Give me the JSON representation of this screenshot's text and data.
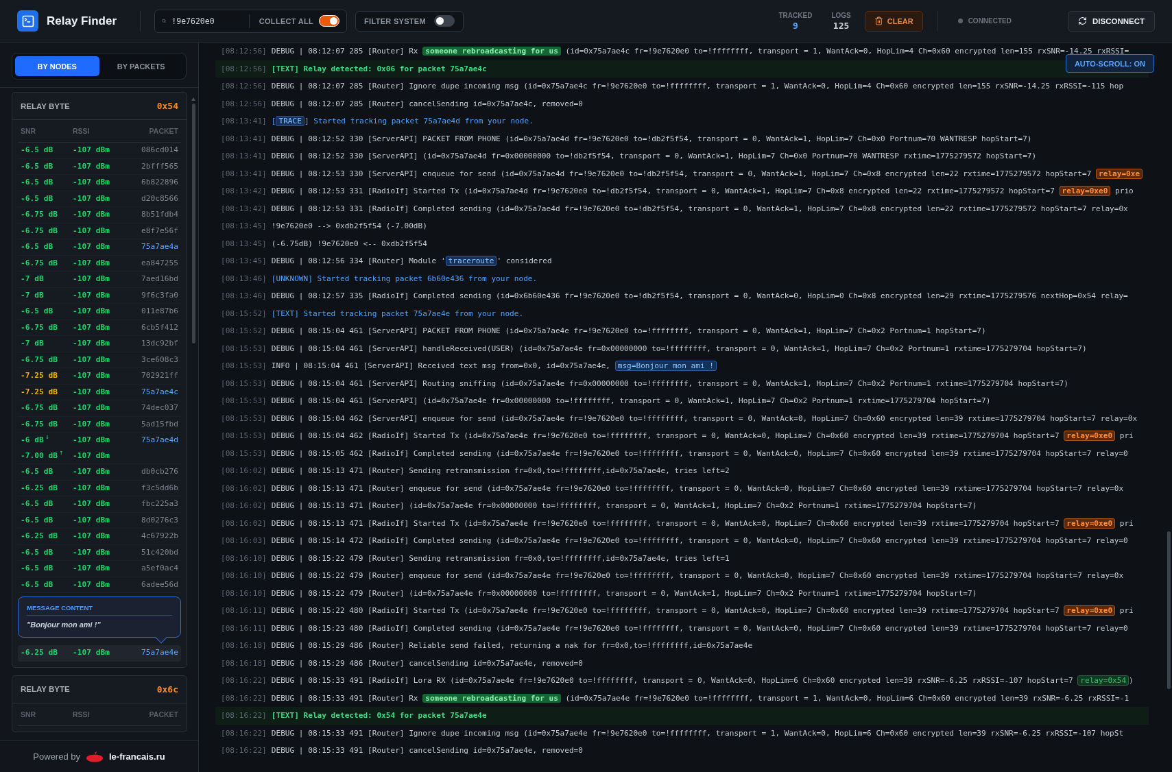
{
  "header": {
    "title": "Relay Finder",
    "search": {
      "value": "!9e7620e0"
    },
    "collect_all": {
      "label": "COLLECT ALL",
      "on": true
    },
    "filter_system": {
      "label": "FILTER SYSTEM",
      "on": false
    },
    "stats": [
      {
        "label": "TRACKED",
        "value": "9",
        "kind": "accent"
      },
      {
        "label": "LOGS",
        "value": "125",
        "kind": "plain"
      }
    ],
    "clear_button": "CLEAR",
    "status": {
      "label": "CONNECTED",
      "connected": false
    },
    "disconnect_button": "DISCONNECT"
  },
  "sidebar": {
    "tabs": [
      {
        "label": "BY NODES",
        "selected": true
      },
      {
        "label": "BY PACKETS",
        "selected": false
      }
    ],
    "cards": [
      {
        "label": "RELAY BYTE",
        "value": "0x54",
        "columns": [
          "SNR",
          "RSSI",
          "PACKET"
        ],
        "tooltip": {
          "title": "MESSAGE CONTENT",
          "text": "\"Bonjour mon ami !\""
        },
        "rows": [
          {
            "packet": "086cd014",
            "tracked": false,
            "hovered": false,
            "readings": [
              {
                "snr": "-6.5 dB",
                "rssi": "-107 dBm",
                "color": "#22d36b"
              }
            ]
          },
          {
            "packet": "2bfff565",
            "tracked": false,
            "hovered": false,
            "readings": [
              {
                "snr": "-6.5 dB",
                "rssi": "-107 dBm",
                "color": "#22d36b"
              }
            ]
          },
          {
            "packet": "6b822896",
            "tracked": false,
            "hovered": false,
            "readings": [
              {
                "snr": "-6.5 dB",
                "rssi": "-107 dBm",
                "color": "#22d36b"
              }
            ]
          },
          {
            "packet": "d20c8566",
            "tracked": false,
            "hovered": false,
            "readings": [
              {
                "snr": "-6.5 dB",
                "rssi": "-107 dBm",
                "color": "#22d36b"
              }
            ]
          },
          {
            "packet": "8b51fdb4",
            "tracked": false,
            "hovered": false,
            "readings": [
              {
                "snr": "-6.75 dB",
                "rssi": "-107 dBm",
                "color": "#22d36b"
              }
            ]
          },
          {
            "packet": "e8f7e56f",
            "tracked": false,
            "hovered": false,
            "readings": [
              {
                "snr": "-6.75 dB",
                "rssi": "-107 dBm",
                "color": "#22d36b"
              }
            ]
          },
          {
            "packet": "75a7ae4a",
            "tracked": true,
            "hovered": false,
            "readings": [
              {
                "snr": "-6.5 dB",
                "rssi": "-107 dBm",
                "color": "#22d36b"
              }
            ]
          },
          {
            "packet": "ea847255",
            "tracked": false,
            "hovered": false,
            "readings": [
              {
                "snr": "-6.75 dB",
                "rssi": "-107 dBm",
                "color": "#22d36b"
              }
            ]
          },
          {
            "packet": "7aed16bd",
            "tracked": false,
            "hovered": false,
            "readings": [
              {
                "snr": "-7 dB",
                "rssi": "-107 dBm",
                "color": "#22d36b"
              }
            ]
          },
          {
            "packet": "9f6c3fa0",
            "tracked": false,
            "hovered": false,
            "readings": [
              {
                "snr": "-7 dB",
                "rssi": "-107 dBm",
                "color": "#22d36b"
              }
            ]
          },
          {
            "packet": "011e87b6",
            "tracked": false,
            "hovered": false,
            "readings": [
              {
                "snr": "-6.5 dB",
                "rssi": "-107 dBm",
                "color": "#22d36b"
              }
            ]
          },
          {
            "packet": "6cb5f412",
            "tracked": false,
            "hovered": false,
            "readings": [
              {
                "snr": "-6.75 dB",
                "rssi": "-107 dBm",
                "color": "#22d36b"
              }
            ]
          },
          {
            "packet": "13dc92bf",
            "tracked": false,
            "hovered": false,
            "readings": [
              {
                "snr": "-7 dB",
                "rssi": "-107 dBm",
                "color": "#22d36b"
              }
            ]
          },
          {
            "packet": "3ce608c3",
            "tracked": false,
            "hovered": false,
            "readings": [
              {
                "snr": "-6.75 dB",
                "rssi": "-107 dBm",
                "color": "#22d36b"
              }
            ]
          },
          {
            "packet": "702921ff",
            "tracked": false,
            "hovered": false,
            "readings": [
              {
                "snr": "-7.25 dB",
                "rssi": "-107 dBm",
                "color": "#f5b400"
              }
            ]
          },
          {
            "packet": "75a7ae4c",
            "tracked": true,
            "hovered": false,
            "readings": [
              {
                "snr": "-7.25 dB",
                "rssi": "-107 dBm",
                "color": "#f5b400"
              }
            ]
          },
          {
            "packet": "74dec037",
            "tracked": false,
            "hovered": false,
            "readings": [
              {
                "snr": "-6.75 dB",
                "rssi": "-107 dBm",
                "color": "#22d36b"
              }
            ]
          },
          {
            "packet": "5ad15fbd",
            "tracked": false,
            "hovered": false,
            "readings": [
              {
                "snr": "-6.75 dB",
                "rssi": "-107 dBm",
                "color": "#22d36b"
              }
            ]
          },
          {
            "packet": "75a7ae4d",
            "tracked": true,
            "hovered": false,
            "readings": [
              {
                "snr": "-6 dB",
                "trend": "↓",
                "rssi": "-107 dBm",
                "color": "#22d36b"
              },
              {
                "snr": "-7.00 dB",
                "trend": "↑",
                "rssi": "-107 dBm",
                "color": "#22d36b"
              }
            ]
          },
          {
            "packet": "db0cb276",
            "tracked": false,
            "hovered": false,
            "readings": [
              {
                "snr": "-6.5 dB",
                "rssi": "-107 dBm",
                "color": "#22d36b"
              }
            ]
          },
          {
            "packet": "f3c5dd6b",
            "tracked": false,
            "hovered": false,
            "readings": [
              {
                "snr": "-6.25 dB",
                "rssi": "-107 dBm",
                "color": "#22d36b"
              }
            ]
          },
          {
            "packet": "fbc225a3",
            "tracked": false,
            "hovered": false,
            "readings": [
              {
                "snr": "-6.5 dB",
                "rssi": "-107 dBm",
                "color": "#22d36b"
              }
            ]
          },
          {
            "packet": "8d0276c3",
            "tracked": false,
            "hovered": false,
            "readings": [
              {
                "snr": "-6.5 dB",
                "rssi": "-107 dBm",
                "color": "#22d36b"
              }
            ]
          },
          {
            "packet": "4c67922b",
            "tracked": false,
            "hovered": false,
            "readings": [
              {
                "snr": "-6.25 dB",
                "rssi": "-107 dBm",
                "color": "#22d36b"
              }
            ]
          },
          {
            "packet": "51c420bd",
            "tracked": false,
            "hovered": false,
            "readings": [
              {
                "snr": "-6.5 dB",
                "rssi": "-107 dBm",
                "color": "#22d36b"
              }
            ]
          },
          {
            "packet": "a5ef0ac4",
            "tracked": false,
            "hovered": false,
            "readings": [
              {
                "snr": "-6.5 dB",
                "rssi": "-107 dBm",
                "color": "#22d36b"
              }
            ]
          },
          {
            "packet": "6adee56d",
            "tracked": false,
            "hovered": false,
            "readings": [
              {
                "snr": "-6.5 dB",
                "rssi": "-107 dBm",
                "color": "#22d36b"
              }
            ]
          },
          {
            "packet": "75a7ae4e",
            "tracked": true,
            "hovered": true,
            "readings": [
              {
                "snr": "-6.25 dB",
                "rssi": "-107 dBm",
                "color": "#22d36b"
              }
            ]
          }
        ]
      },
      {
        "label": "RELAY BYTE",
        "value": "0x6c",
        "columns": [
          "SNR",
          "RSSI",
          "PACKET"
        ]
      }
    ],
    "footer": {
      "prefix": "Powered by",
      "brand": "le-francais.ru"
    }
  },
  "log": {
    "auto_scroll": {
      "label": "AUTO-SCROLL: ON",
      "on": true
    },
    "lines": [
      {
        "time": "[08:12:56]",
        "kind": "debug",
        "parts": [
          {
            "kind": "plain",
            "text": "DEBUG | 08:12:07 285 [Router] Rx "
          },
          {
            "kind": "rebroadcast",
            "text": "someone rebroadcasting for us"
          },
          {
            "kind": "plain",
            "text": " (id=0x75a7ae4c fr=!9e7620e0 to=!ffffffff, transport = 1, WantAck=0, HopLim=4 Ch=0x60 encrypted len=155 rxSNR=-14.25 rxRSSI="
          }
        ]
      },
      {
        "time": "[08:12:56]",
        "kind": "relay",
        "parts": [
          {
            "kind": "plain",
            "text": "[TEXT] Relay detected: 0x06 for packet 75a7ae4c"
          }
        ]
      },
      {
        "time": "[08:12:56]",
        "kind": "debug",
        "parts": [
          {
            "kind": "plain",
            "text": "DEBUG | 08:12:07 285 [Router] Ignore dupe incoming msg (id=0x75a7ae4c fr=!9e7620e0 to=!ffffffff, transport = 1, WantAck=0, HopLim=4 Ch=0x60 encrypted len=155 rxSNR=-14.25 rxRSSI=-115 hop"
          }
        ]
      },
      {
        "time": "[08:12:56]",
        "kind": "debug",
        "parts": [
          {
            "kind": "plain",
            "text": "DEBUG | 08:12:07 285 [Router] cancelSending id=0x75a7ae4c, removed=0"
          }
        ]
      },
      {
        "time": "[08:13:41]",
        "kind": "tracking",
        "parts": [
          {
            "kind": "plain",
            "text": "["
          },
          {
            "kind": "info",
            "text": "TRACE"
          },
          {
            "kind": "plain",
            "text": "] Started tracking packet 75a7ae4d from your node."
          }
        ]
      },
      {
        "time": "[08:13:41]",
        "kind": "debug",
        "parts": [
          {
            "kind": "plain",
            "text": "DEBUG | 08:12:52 330 [ServerAPI] PACKET FROM PHONE (id=0x75a7ae4d fr=!9e7620e0 to=!db2f5f54, transport = 0, WantAck=1, HopLim=7 Ch=0x0 Portnum=70 WANTRESP hopStart=7)"
          }
        ]
      },
      {
        "time": "[08:13:41]",
        "kind": "debug",
        "parts": [
          {
            "kind": "plain",
            "text": "DEBUG | 08:12:52 330 [ServerAPI] (id=0x75a7ae4d fr=0x00000000 to=!db2f5f54, transport = 0, WantAck=1, HopLim=7 Ch=0x0 Portnum=70 WANTRESP rxtime=1775279572 hopStart=7)"
          }
        ]
      },
      {
        "time": "[08:13:41]",
        "kind": "debug",
        "parts": [
          {
            "kind": "plain",
            "text": "DEBUG | 08:12:53 330 [ServerAPI] enqueue for send (id=0x75a7ae4d fr=!9e7620e0 to=!db2f5f54, transport = 0, WantAck=1, HopLim=7 Ch=0x8 encrypted len=22 rxtime=1775279572 hopStart=7 "
          },
          {
            "kind": "relay",
            "text": "relay=0xe"
          }
        ]
      },
      {
        "time": "[08:13:42]",
        "kind": "debug",
        "parts": [
          {
            "kind": "plain",
            "text": "DEBUG | 08:12:53 331 [RadioIf] Started Tx (id=0x75a7ae4d fr=!9e7620e0 to=!db2f5f54, transport = 0, WantAck=1, HopLim=7 Ch=0x8 encrypted len=22 rxtime=1775279572 hopStart=7 "
          },
          {
            "kind": "relay",
            "text": "relay=0xe0"
          },
          {
            "kind": "plain",
            "text": " prio"
          }
        ]
      },
      {
        "time": "[08:13:42]",
        "kind": "debug",
        "parts": [
          {
            "kind": "plain",
            "text": "DEBUG | 08:12:53 331 [RadioIf] Completed sending (id=0x75a7ae4d fr=!9e7620e0 to=!db2f5f54, transport = 0, WantAck=1, HopLim=7 Ch=0x8 encrypted len=22 rxtime=1775279572 hopStart=7 relay=0x"
          }
        ]
      },
      {
        "time": "[08:13:45]",
        "kind": "debug",
        "parts": [
          {
            "kind": "plain",
            "text": "!9e7620e0 --> 0xdb2f5f54 (-7.00dB)"
          }
        ]
      },
      {
        "time": "[08:13:45]",
        "kind": "debug",
        "parts": [
          {
            "kind": "plain",
            "text": "(-6.75dB) !9e7620e0 <-- 0xdb2f5f54"
          }
        ]
      },
      {
        "time": "[08:13:45]",
        "kind": "debug",
        "parts": [
          {
            "kind": "plain",
            "text": "DEBUG | 08:12:56 334 [Router] Module '"
          },
          {
            "kind": "info",
            "text": "traceroute"
          },
          {
            "kind": "plain",
            "text": "' considered"
          }
        ]
      },
      {
        "time": "[08:13:46]",
        "kind": "tracking",
        "parts": [
          {
            "kind": "plain",
            "text": "[UNKNOWN] Started tracking packet 6b60e436 from your node."
          }
        ]
      },
      {
        "time": "[08:13:46]",
        "kind": "debug",
        "parts": [
          {
            "kind": "plain",
            "text": "DEBUG | 08:12:57 335 [RadioIf] Completed sending (id=0x6b60e436 fr=!9e7620e0 to=!db2f5f54, transport = 0, WantAck=0, HopLim=0 Ch=0x8 encrypted len=29 rxtime=1775279576 nextHop=0x54 relay="
          }
        ]
      },
      {
        "time": "[08:15:52]",
        "kind": "tracking",
        "parts": [
          {
            "kind": "plain",
            "text": "[TEXT] Started tracking packet 75a7ae4e from your node."
          }
        ]
      },
      {
        "time": "[08:15:52]",
        "kind": "debug",
        "parts": [
          {
            "kind": "plain",
            "text": "DEBUG | 08:15:04 461 [ServerAPI] PACKET FROM PHONE (id=0x75a7ae4e fr=!9e7620e0 to=!ffffffff, transport = 0, WantAck=1, HopLim=7 Ch=0x2 Portnum=1 hopStart=7)"
          }
        ]
      },
      {
        "time": "[08:15:53]",
        "kind": "debug",
        "parts": [
          {
            "kind": "plain",
            "text": "DEBUG | 08:15:04 461 [ServerAPI] handleReceived(USER) (id=0x75a7ae4e fr=0x00000000 to=!ffffffff, transport = 0, WantAck=1, HopLim=7 Ch=0x2 Portnum=1 rxtime=1775279704 hopStart=7)"
          }
        ]
      },
      {
        "time": "[08:15:53]",
        "kind": "debug",
        "parts": [
          {
            "kind": "plain",
            "text": "INFO | 08:15:04 461 [ServerAPI] Received text msg from=0x0, id=0x75a7ae4e, "
          },
          {
            "kind": "info",
            "text": "msg=Bonjour mon ami !"
          }
        ]
      },
      {
        "time": "[08:15:53]",
        "kind": "debug",
        "parts": [
          {
            "kind": "plain",
            "text": "DEBUG | 08:15:04 461 [ServerAPI] Routing sniffing (id=0x75a7ae4e fr=0x00000000 to=!ffffffff, transport = 0, WantAck=1, HopLim=7 Ch=0x2 Portnum=1 rxtime=1775279704 hopStart=7)"
          }
        ]
      },
      {
        "time": "[08:15:53]",
        "kind": "debug",
        "parts": [
          {
            "kind": "plain",
            "text": "DEBUG | 08:15:04 461 [ServerAPI] (id=0x75a7ae4e fr=0x00000000 to=!ffffffff, transport = 0, WantAck=1, HopLim=7 Ch=0x2 Portnum=1 rxtime=1775279704 hopStart=7)"
          }
        ]
      },
      {
        "time": "[08:15:53]",
        "kind": "debug",
        "parts": [
          {
            "kind": "plain",
            "text": "DEBUG | 08:15:04 462 [ServerAPI] enqueue for send (id=0x75a7ae4e fr=!9e7620e0 to=!ffffffff, transport = 0, WantAck=0, HopLim=7 Ch=0x60 encrypted len=39 rxtime=1775279704 hopStart=7 relay=0x"
          }
        ]
      },
      {
        "time": "[08:15:53]",
        "kind": "debug",
        "parts": [
          {
            "kind": "plain",
            "text": "DEBUG | 08:15:04 462 [RadioIf] Started Tx (id=0x75a7ae4e fr=!9e7620e0 to=!ffffffff, transport = 0, WantAck=0, HopLim=7 Ch=0x60 encrypted len=39 rxtime=1775279704 hopStart=7 "
          },
          {
            "kind": "relay",
            "text": "relay=0xe0"
          },
          {
            "kind": "plain",
            "text": " pri"
          }
        ]
      },
      {
        "time": "[08:15:53]",
        "kind": "debug",
        "parts": [
          {
            "kind": "plain",
            "text": "DEBUG | 08:15:05 462 [RadioIf] Completed sending (id=0x75a7ae4e fr=!9e7620e0 to=!ffffffff, transport = 0, WantAck=0, HopLim=7 Ch=0x60 encrypted len=39 rxtime=1775279704 hopStart=7 relay=0"
          }
        ]
      },
      {
        "time": "[08:16:02]",
        "kind": "debug",
        "parts": [
          {
            "kind": "plain",
            "text": "DEBUG | 08:15:13 471 [Router] Sending retransmission fr=0x0,to=!ffffffff,id=0x75a7ae4e, tries left=2"
          }
        ]
      },
      {
        "time": "[08:16:02]",
        "kind": "debug",
        "parts": [
          {
            "kind": "plain",
            "text": "DEBUG | 08:15:13 471 [Router] enqueue for send (id=0x75a7ae4e fr=!9e7620e0 to=!ffffffff, transport = 0, WantAck=0, HopLim=7 Ch=0x60 encrypted len=39 rxtime=1775279704 hopStart=7 relay=0x"
          }
        ]
      },
      {
        "time": "[08:16:02]",
        "kind": "debug",
        "parts": [
          {
            "kind": "plain",
            "text": "DEBUG | 08:15:13 471 [Router] (id=0x75a7ae4e fr=0x00000000 to=!ffffffff, transport = 0, WantAck=1, HopLim=7 Ch=0x2 Portnum=1 rxtime=1775279704 hopStart=7)"
          }
        ]
      },
      {
        "time": "[08:16:02]",
        "kind": "debug",
        "parts": [
          {
            "kind": "plain",
            "text": "DEBUG | 08:15:13 471 [RadioIf] Started Tx (id=0x75a7ae4e fr=!9e7620e0 to=!ffffffff, transport = 0, WantAck=0, HopLim=7 Ch=0x60 encrypted len=39 rxtime=1775279704 hopStart=7 "
          },
          {
            "kind": "relay",
            "text": "relay=0xe0"
          },
          {
            "kind": "plain",
            "text": " pri"
          }
        ]
      },
      {
        "time": "[08:16:03]",
        "kind": "debug",
        "parts": [
          {
            "kind": "plain",
            "text": "DEBUG | 08:15:14 472 [RadioIf] Completed sending (id=0x75a7ae4e fr=!9e7620e0 to=!ffffffff, transport = 0, WantAck=0, HopLim=7 Ch=0x60 encrypted len=39 rxtime=1775279704 hopStart=7 relay=0"
          }
        ]
      },
      {
        "time": "[08:16:10]",
        "kind": "debug",
        "parts": [
          {
            "kind": "plain",
            "text": "DEBUG | 08:15:22 479 [Router] Sending retransmission fr=0x0,to=!ffffffff,id=0x75a7ae4e, tries left=1"
          }
        ]
      },
      {
        "time": "[08:16:10]",
        "kind": "debug",
        "parts": [
          {
            "kind": "plain",
            "text": "DEBUG | 08:15:22 479 [Router] enqueue for send (id=0x75a7ae4e fr=!9e7620e0 to=!ffffffff, transport = 0, WantAck=0, HopLim=7 Ch=0x60 encrypted len=39 rxtime=1775279704 hopStart=7 relay=0x"
          }
        ]
      },
      {
        "time": "[08:16:10]",
        "kind": "debug",
        "parts": [
          {
            "kind": "plain",
            "text": "DEBUG | 08:15:22 479 [Router] (id=0x75a7ae4e fr=0x00000000 to=!ffffffff, transport = 0, WantAck=1, HopLim=7 Ch=0x2 Portnum=1 rxtime=1775279704 hopStart=7)"
          }
        ]
      },
      {
        "time": "[08:16:11]",
        "kind": "debug",
        "parts": [
          {
            "kind": "plain",
            "text": "DEBUG | 08:15:22 480 [RadioIf] Started Tx (id=0x75a7ae4e fr=!9e7620e0 to=!ffffffff, transport = 0, WantAck=0, HopLim=7 Ch=0x60 encrypted len=39 rxtime=1775279704 hopStart=7 "
          },
          {
            "kind": "relay",
            "text": "relay=0xe0"
          },
          {
            "kind": "plain",
            "text": " pri"
          }
        ]
      },
      {
        "time": "[08:16:11]",
        "kind": "debug",
        "parts": [
          {
            "kind": "plain",
            "text": "DEBUG | 08:15:23 480 [RadioIf] Completed sending (id=0x75a7ae4e fr=!9e7620e0 to=!ffffffff, transport = 0, WantAck=0, HopLim=7 Ch=0x60 encrypted len=39 rxtime=1775279704 hopStart=7 relay=0"
          }
        ]
      },
      {
        "time": "[08:16:18]",
        "kind": "debug",
        "parts": [
          {
            "kind": "plain",
            "text": "DEBUG | 08:15:29 486 [Router] Reliable send failed, returning a nak for fr=0x0,to=!ffffffff,id=0x75a7ae4e"
          }
        ]
      },
      {
        "time": "[08:16:18]",
        "kind": "debug",
        "parts": [
          {
            "kind": "plain",
            "text": "DEBUG | 08:15:29 486 [Router] cancelSending id=0x75a7ae4e, removed=0"
          }
        ]
      },
      {
        "time": "[08:16:22]",
        "kind": "debug",
        "parts": [
          {
            "kind": "plain",
            "text": "DEBUG | 08:15:33 491 [RadioIf] Lora RX (id=0x75a7ae4e fr=!9e7620e0 to=!ffffffff, transport = 0, WantAck=0, HopLim=6 Ch=0x60 encrypted len=39 rxSNR=-6.25 rxRSSI=-107 hopStart=7 "
          },
          {
            "kind": "match",
            "text": "relay=0x54"
          },
          {
            "kind": "plain",
            "text": ")"
          }
        ]
      },
      {
        "time": "[08:16:22]",
        "kind": "debug",
        "parts": [
          {
            "kind": "plain",
            "text": "DEBUG | 08:15:33 491 [Router] Rx "
          },
          {
            "kind": "rebroadcast",
            "text": "someone rebroadcasting for us"
          },
          {
            "kind": "plain",
            "text": " (id=0x75a7ae4e fr=!9e7620e0 to=!ffffffff, transport = 1, WantAck=0, HopLim=6 Ch=0x60 encrypted len=39 rxSNR=-6.25 rxRSSI=-1"
          }
        ]
      },
      {
        "time": "[08:16:22]",
        "kind": "relay",
        "parts": [
          {
            "kind": "plain",
            "text": "[TEXT] Relay detected: 0x54 for packet 75a7ae4e"
          }
        ]
      },
      {
        "time": "[08:16:22]",
        "kind": "debug",
        "parts": [
          {
            "kind": "plain",
            "text": "DEBUG | 08:15:33 491 [Router] Ignore dupe incoming msg (id=0x75a7ae4e fr=!9e7620e0 to=!ffffffff, transport = 1, WantAck=0, HopLim=6 Ch=0x60 encrypted len=39 rxSNR=-6.25 rxRSSI=-107 hopSt"
          }
        ]
      },
      {
        "time": "[08:16:22]",
        "kind": "debug",
        "parts": [
          {
            "kind": "plain",
            "text": "DEBUG | 08:15:33 491 [Router] cancelSending id=0x75a7ae4e, removed=0"
          }
        ]
      }
    ]
  }
}
